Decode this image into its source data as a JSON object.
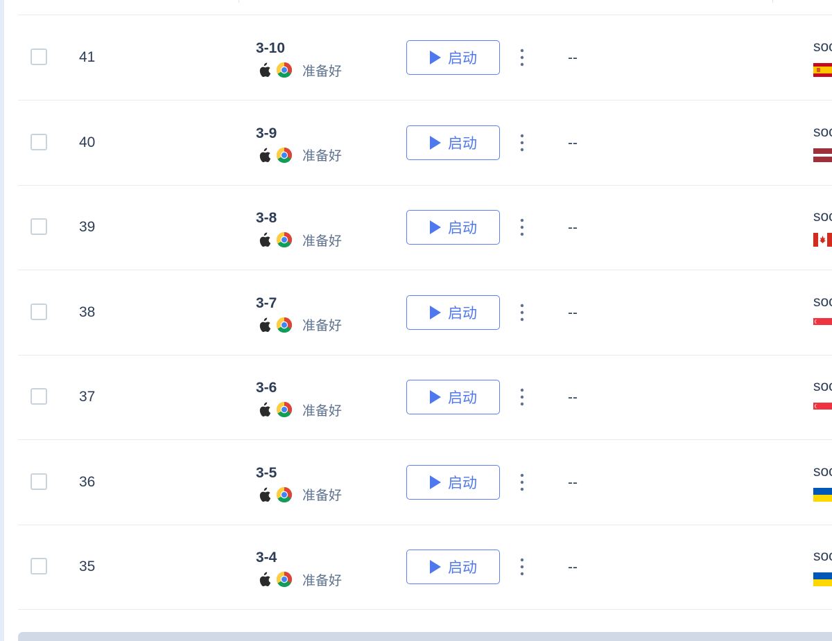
{
  "rows": [
    {
      "id": "41",
      "name": "3-10",
      "status": "准备好",
      "start_label": "启动",
      "last_launch": "--",
      "proxy": "soc",
      "flag": "es"
    },
    {
      "id": "40",
      "name": "3-9",
      "status": "准备好",
      "start_label": "启动",
      "last_launch": "--",
      "proxy": "soc",
      "flag": "lv"
    },
    {
      "id": "39",
      "name": "3-8",
      "status": "准备好",
      "start_label": "启动",
      "last_launch": "--",
      "proxy": "soc",
      "flag": "ca"
    },
    {
      "id": "38",
      "name": "3-7",
      "status": "准备好",
      "start_label": "启动",
      "last_launch": "--",
      "proxy": "soc",
      "flag": "sg"
    },
    {
      "id": "37",
      "name": "3-6",
      "status": "准备好",
      "start_label": "启动",
      "last_launch": "--",
      "proxy": "soc",
      "flag": "sg"
    },
    {
      "id": "36",
      "name": "3-5",
      "status": "准备好",
      "start_label": "启动",
      "last_launch": "--",
      "proxy": "soc",
      "flag": "ua"
    },
    {
      "id": "35",
      "name": "3-4",
      "status": "准备好",
      "start_label": "启动",
      "last_launch": "--",
      "proxy": "soc",
      "flag": "ua"
    }
  ],
  "icons": {
    "os": "apple-icon",
    "browser": "chrome-icon",
    "start": "play-icon",
    "more": "more-vertical-icon"
  },
  "colors": {
    "accent": "#4f78ee",
    "text": "#2d3d57",
    "muted": "#5d718e",
    "divider": "#e8ecf2"
  }
}
